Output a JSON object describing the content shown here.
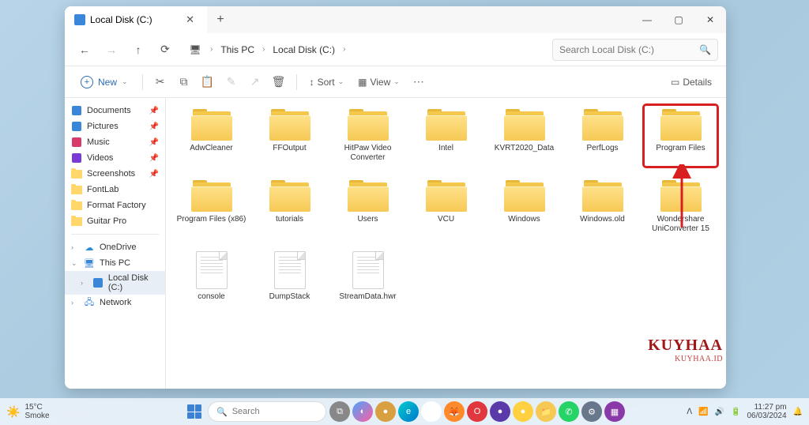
{
  "window": {
    "title": "Local Disk (C:)",
    "controls": {
      "minimize": "—",
      "maximize": "▢",
      "close": "✕"
    }
  },
  "nav": {
    "back": "←",
    "forward": "→",
    "up": "↑",
    "refresh": "⟳",
    "pc_icon": "🖥",
    "breadcrumb": [
      "This PC",
      "Local Disk (C:)"
    ],
    "search_placeholder": "Search Local Disk (C:)"
  },
  "toolbar": {
    "new": "New",
    "sort": "Sort",
    "view": "View",
    "details": "Details"
  },
  "sidebar": {
    "quick": [
      {
        "name": "Documents",
        "icon": "doc",
        "color": "#3a86d8",
        "pinned": true
      },
      {
        "name": "Pictures",
        "icon": "pic",
        "color": "#3a86d8",
        "pinned": true
      },
      {
        "name": "Music",
        "icon": "music",
        "color": "#d83a6a",
        "pinned": true
      },
      {
        "name": "Videos",
        "icon": "video",
        "color": "#7a3ad8",
        "pinned": true
      },
      {
        "name": "Screenshots",
        "icon": "folder",
        "color": "#f5c94d",
        "pinned": true
      },
      {
        "name": "FontLab",
        "icon": "folder",
        "color": "#f5c94d",
        "pinned": false
      },
      {
        "name": "Format Factory",
        "icon": "folder",
        "color": "#f5c94d",
        "pinned": false
      },
      {
        "name": "Guitar Pro",
        "icon": "folder",
        "color": "#f5c94d",
        "pinned": false
      }
    ],
    "main": [
      {
        "name": "OneDrive",
        "icon": "cloud",
        "color": "#2b8cd8",
        "expanded": false,
        "caret": "›"
      },
      {
        "name": "This PC",
        "icon": "pc",
        "color": "#3a86d8",
        "expanded": true,
        "caret": "⌄"
      }
    ],
    "thispc_children": [
      {
        "name": "Local Disk (C:)",
        "icon": "disk",
        "color": "#3a86d8",
        "selected": true,
        "caret": "›"
      }
    ],
    "network": [
      {
        "name": "Network",
        "icon": "net",
        "color": "#3a86d8",
        "caret": "›"
      }
    ]
  },
  "content": {
    "folders": [
      "AdwCleaner",
      "FFOutput",
      "HitPaw Video Converter",
      "Intel",
      "KVRT2020_Data",
      "PerfLogs",
      "Program Files",
      "Program Files (x86)",
      "tutorials",
      "Users",
      "VCU",
      "Windows",
      "Windows.old",
      "Wondershare UniConverter 15"
    ],
    "files": [
      "console",
      "DumpStack",
      "StreamData.hwr"
    ],
    "highlighted_folder": "Program Files"
  },
  "watermark": {
    "big": "KUYHAA",
    "small": "KUYHAA.ID"
  },
  "taskbar": {
    "weather": {
      "temp": "15°C",
      "cond": "Smoke"
    },
    "search": "Search",
    "tray": {
      "time": "11:27 pm",
      "date": "06/03/2024"
    }
  },
  "tb_apps": [
    {
      "name": "task-view",
      "bg": "#888",
      "glyph": "⧉"
    },
    {
      "name": "copilot",
      "bg": "linear-gradient(135deg,#4aa3ff,#ff5ea0)",
      "glyph": "◐"
    },
    {
      "name": "app-1",
      "bg": "#d8a040",
      "glyph": "●"
    },
    {
      "name": "edge",
      "bg": "linear-gradient(135deg,#0cc,#07c)",
      "glyph": "e"
    },
    {
      "name": "chrome",
      "bg": "#fff",
      "glyph": "◎"
    },
    {
      "name": "firefox",
      "bg": "#ff8a2b",
      "glyph": "🦊"
    },
    {
      "name": "opera",
      "bg": "#e0383e",
      "glyph": "O"
    },
    {
      "name": "app-2",
      "bg": "#5a3aa8",
      "glyph": "●"
    },
    {
      "name": "app-3",
      "bg": "#ffd040",
      "glyph": "●"
    },
    {
      "name": "explorer",
      "bg": "#f6c955",
      "glyph": "📁"
    },
    {
      "name": "whatsapp",
      "bg": "#25d366",
      "glyph": "✆"
    },
    {
      "name": "settings",
      "bg": "#68788a",
      "glyph": "⚙"
    },
    {
      "name": "app-4",
      "bg": "#8a3aa8",
      "glyph": "▦"
    }
  ]
}
